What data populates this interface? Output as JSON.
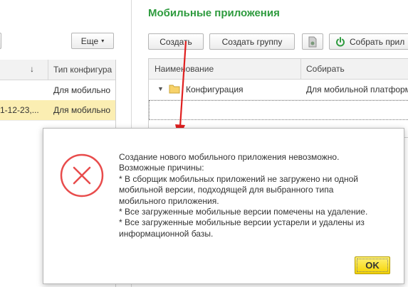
{
  "left_panel": {
    "more_button": "Еще",
    "sort_indicator": "↓",
    "column_header": "Тип конфигура",
    "rows": [
      {
        "col_a": "",
        "col_b": "Для мобильно"
      },
      {
        "col_a": "1-12-23,...",
        "col_b": "Для мобильно"
      }
    ]
  },
  "main": {
    "title": "Мобильные приложения",
    "toolbar": {
      "create": "Создать",
      "create_group": "Создать группу",
      "collect": "Собрать прил"
    },
    "table": {
      "columns": [
        "Наименование",
        "Собирать"
      ],
      "rows": [
        {
          "name": "Конфигурация",
          "collect": "Для мобильной платформ"
        }
      ]
    }
  },
  "dialog": {
    "message_lines": [
      "Создание нового мобильного приложения невозможно.",
      "Возможные причины:",
      "* В сборщик мобильных приложений не загружено ни одной",
      "мобильной версии, подходящей для выбранного типа",
      "мобильного приложения.",
      "* Все загруженные мобильные версии помечены на удаление.",
      "* Все загруженные мобильные версии устарели и удалены из",
      "информационной базы."
    ],
    "ok_label": "OK"
  },
  "colors": {
    "title_green": "#2e9b3e",
    "error_red": "#e84c4c",
    "annotation_arrow": "#e02020",
    "ok_yellow": "#f5d400",
    "selected_row": "#fbeeb2"
  },
  "icons": {
    "error": "error-x-circle-icon",
    "folder": "folder-icon",
    "power": "power-icon",
    "toolbar_icon": "document-icon"
  }
}
